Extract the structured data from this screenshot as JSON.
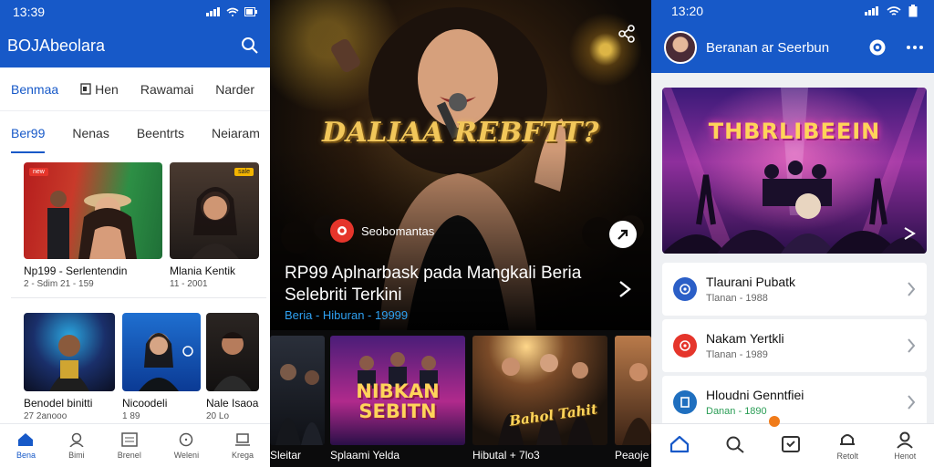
{
  "left": {
    "status": {
      "time": "13:39"
    },
    "appbar": {
      "title": "BOJAbeolara"
    },
    "tabs_top": [
      {
        "label": "Benmaa"
      },
      {
        "label": "Hen"
      },
      {
        "label": "Rawamai"
      },
      {
        "label": "Narder"
      }
    ],
    "tabs_second": [
      {
        "label": "Ber99"
      },
      {
        "label": "Nenas"
      },
      {
        "label": "Beentrts"
      },
      {
        "label": "Neiaram"
      }
    ],
    "cards_row1": [
      {
        "badge": "new",
        "title": "Np199 - Serlentendin",
        "meta": "2 - Sdim 21 - 159"
      },
      {
        "badge": "sale",
        "title": "Mlania Kentik",
        "meta": "11 - 2001"
      }
    ],
    "cards_row2": [
      {
        "badge": "",
        "title": "Benodel binitti",
        "meta": "27 2anooo"
      },
      {
        "badge": "",
        "title": "Nicoodeli",
        "meta": "1 89"
      },
      {
        "badge": "",
        "title": "Nale Isaoal",
        "meta": "20 Lo"
      }
    ],
    "bottom_nav": [
      {
        "label": "Bena",
        "icon": "home-icon"
      },
      {
        "label": "Bimi",
        "icon": "user-icon"
      },
      {
        "label": "Brenel",
        "icon": "list-icon"
      },
      {
        "label": "Weleni",
        "icon": "chat-icon"
      },
      {
        "label": "Krega",
        "icon": "laptop-icon"
      }
    ]
  },
  "middle": {
    "hero": {
      "title": "DALIAA REBFTT?",
      "brand": "Seobomantas",
      "headline": "RP99 Aplnarbask pada Mangkali Beria Selebriti Terkini",
      "meta": "Beria - Hiburan - 19999"
    },
    "strip": [
      {
        "caption": "Sleitar",
        "art": ""
      },
      {
        "caption": "Splaami Yelda",
        "art": "NIBKAN SEBITN"
      },
      {
        "caption": "Hibutal + 7lo3",
        "art": "Bahol Tahit"
      },
      {
        "caption": "Peaoje",
        "art": ""
      }
    ]
  },
  "right": {
    "status": {
      "time": "13:20"
    },
    "appbar": {
      "title": "Beranan ar Seerbun"
    },
    "hero": {
      "title": "THBRLIBEEIN"
    },
    "list": [
      {
        "title": "Tlaurani Pubatk",
        "meta": "Tlanan - 1988",
        "highlight": false,
        "icon_color": "#2b5fc7"
      },
      {
        "title": "Nakam Yertkli",
        "meta": "Tlanan - 1989",
        "highlight": false,
        "icon_color": "#e5352b"
      },
      {
        "title": "Hloudni Genntfiei",
        "meta": "Danan - 1890",
        "highlight": true,
        "icon_color": "#1f6fbf"
      }
    ],
    "bottom_nav": [
      {
        "label": "",
        "icon": "home-icon"
      },
      {
        "label": "",
        "icon": "search-icon"
      },
      {
        "label": "",
        "icon": "bookmark-check-icon"
      },
      {
        "label": "Retolt",
        "icon": "bell-icon"
      },
      {
        "label": "Henot",
        "icon": "profile-icon"
      }
    ]
  }
}
